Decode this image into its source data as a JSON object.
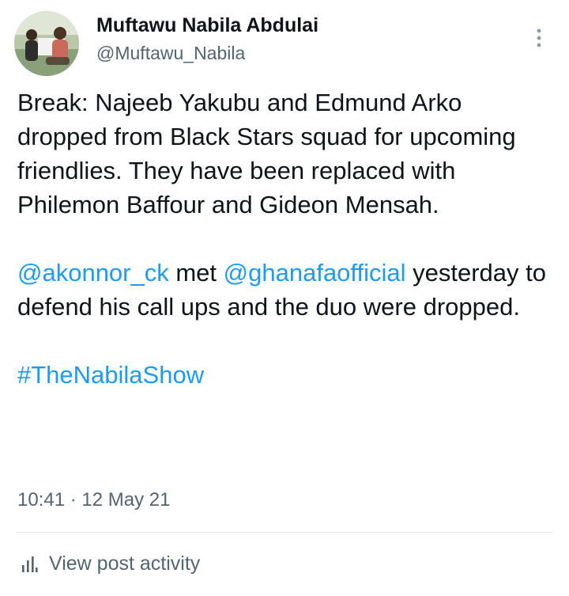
{
  "author": {
    "display_name": "Muftawu Nabila Abdulai",
    "handle": "@Muftawu_Nabila"
  },
  "tweet": {
    "paragraph1": "Break: Najeeb Yakubu and Edmund Arko dropped from Black Stars squad for upcoming friendlies. They have been replaced with Philemon Baffour and Gideon Mensah.",
    "mention1": "@akonnor_ck",
    "text_met": " met ",
    "mention2": "@ghanafaofficial",
    "paragraph2_rest": " yesterday to defend his call ups and the duo were dropped.",
    "hashtag": "#TheNabilaShow"
  },
  "timestamp": "10:41 · 12 May 21",
  "actions": {
    "view_activity_label": "View post activity"
  },
  "colors": {
    "link": "#1d9bf0",
    "secondary_text": "#536471",
    "primary_text": "#0f1419"
  },
  "icons": {
    "more": "more-vertical-icon",
    "activity": "analytics-bar-icon"
  }
}
